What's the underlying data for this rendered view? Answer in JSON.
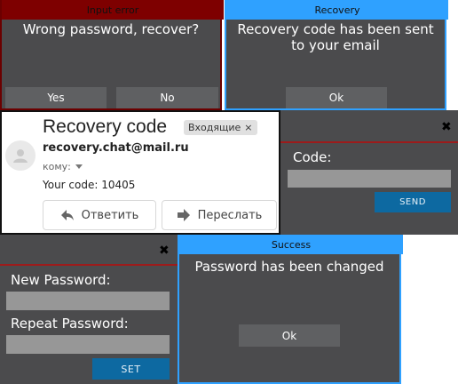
{
  "input_error": {
    "title": "Input error",
    "message": "Wrong password, recover?",
    "yes_label": "Yes",
    "no_label": "No"
  },
  "recovery": {
    "title": "Recovery",
    "message": "Recovery code has been sent to your email",
    "ok_label": "Ok"
  },
  "mail": {
    "subject": "Recovery code",
    "folder_badge": "Входящие",
    "badge_close": "×",
    "sender": "recovery.chat@mail.ru",
    "to_label": "кому:",
    "body": "Your code: 10405",
    "reply_label": "Ответить",
    "forward_label": "Переслать"
  },
  "code_dialog": {
    "close": "✖",
    "code_label": "Code:",
    "code_value": "",
    "send_label": "SEND"
  },
  "password_dialog": {
    "close": "✖",
    "new_label": "New Password:",
    "new_value": "",
    "repeat_label": "Repeat Password:",
    "repeat_value": "",
    "set_label": "SET"
  },
  "success": {
    "title": "Success",
    "message": "Password has been changed",
    "ok_label": "Ok"
  },
  "colors": {
    "error_title": "#7e0000",
    "info_title": "#2fa1ff",
    "dialog_bg": "#4b4b4d",
    "accent_button": "#0d69a1"
  }
}
